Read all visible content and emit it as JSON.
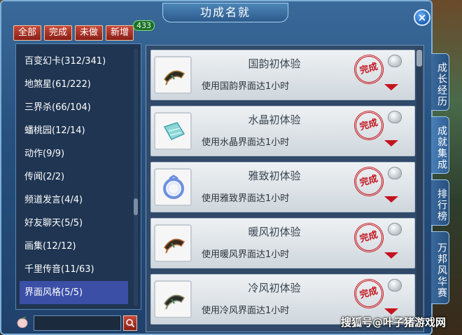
{
  "window": {
    "title": "功成名就",
    "close_label": "×"
  },
  "filters": [
    {
      "label": "全部"
    },
    {
      "label": "完成"
    },
    {
      "label": "未做"
    },
    {
      "label": "新增"
    }
  ],
  "new_count": "433",
  "categories": [
    {
      "label": "百变幻卡(312/341)"
    },
    {
      "label": "地煞星(61/222)"
    },
    {
      "label": "三界杀(66/104)"
    },
    {
      "label": "蟠桃园(12/14)"
    },
    {
      "label": "动作(9/9)"
    },
    {
      "label": "传闻(2/2)"
    },
    {
      "label": "频道发言(4/4)"
    },
    {
      "label": "好友聊天(5/5)"
    },
    {
      "label": "画集(12/12)"
    },
    {
      "label": "千里传音(11/63)"
    },
    {
      "label": "界面风格(5/5)"
    }
  ],
  "selected_category": "界面风格(5/5)",
  "search": {
    "value": "",
    "button_icon": "search-icon"
  },
  "achievements": [
    {
      "title": "国韵初体验",
      "desc": "使用国韵界面达1小时",
      "stamp": "完成",
      "icon": "fan-icon"
    },
    {
      "title": "水晶初体验",
      "desc": "使用水晶界面达1小时",
      "stamp": "完成",
      "icon": "crystal-icon"
    },
    {
      "title": "雅致初体验",
      "desc": "使用雅致界面达1小时",
      "stamp": "完成",
      "icon": "ring-icon"
    },
    {
      "title": "暖风初体验",
      "desc": "使用暖风界面达1小时",
      "stamp": "完成",
      "icon": "fan-icon"
    },
    {
      "title": "冷风初体验",
      "desc": "使用冷风界面达1小时",
      "stamp": "完成",
      "icon": "fan-icon"
    }
  ],
  "side_tabs": [
    {
      "label": "成长经历"
    },
    {
      "label": "成就集成"
    },
    {
      "label": "排行榜"
    },
    {
      "label": "万邦风华赛"
    }
  ],
  "watermark": "搜狐号@叶子猪游戏网",
  "colors": {
    "accent_red": "#c4141d",
    "panel_blue": "#27507e",
    "selected": "#3b4fa6"
  }
}
